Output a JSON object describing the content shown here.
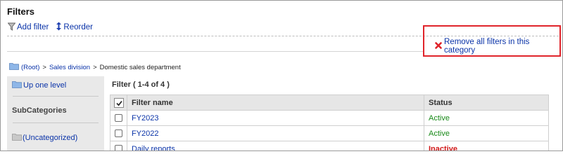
{
  "page": {
    "title": "Filters"
  },
  "toolbar": {
    "add_filter": {
      "label": "Add filter",
      "icon": "funnel-icon"
    },
    "reorder": {
      "label": "Reorder",
      "icon": "up-down-arrow-icon"
    }
  },
  "remove_all": {
    "label": "Remove all filters in this category",
    "icon": "red-x-icon",
    "highlight_color": "#e0242b"
  },
  "breadcrumb": {
    "items": [
      {
        "label": "(Root)",
        "link": true
      },
      {
        "label": "Sales division",
        "link": true
      },
      {
        "label": "Domestic sales department",
        "link": false
      }
    ],
    "separator": ">"
  },
  "sidebar": {
    "up_one_level": "Up one level",
    "subcategories_heading": "SubCategories",
    "uncategorized": "(Uncategorized)"
  },
  "filters": {
    "count_label": "Filter ( 1-4 of 4 )",
    "columns": {
      "name": "Filter name",
      "status": "Status"
    },
    "rows": [
      {
        "name": "FY2023",
        "status": "Active",
        "status_color": "#1a8a1a"
      },
      {
        "name": "FY2022",
        "status": "Active",
        "status_color": "#1a8a1a"
      },
      {
        "name": "Daily reports",
        "status": "Inactive",
        "status_color": "#d01818"
      }
    ]
  },
  "colors": {
    "link": "#0a33a8",
    "header_bg": "#e6e6e6",
    "sidebar_bg": "#e9e9e9"
  }
}
